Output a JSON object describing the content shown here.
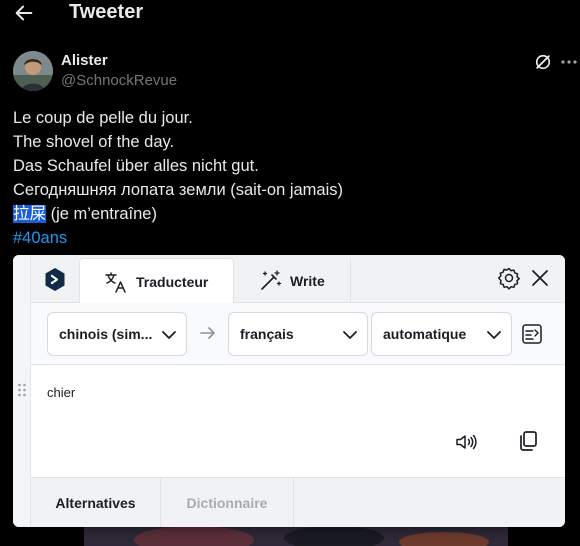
{
  "header": {
    "title": "Tweeter"
  },
  "tweet": {
    "author_name": "Alister",
    "author_handle": "@SchnockRevue",
    "lines": [
      "Le coup de pelle du jour.",
      "The shovel of the day.",
      "Das Schaufel über alles nicht gut.",
      "Сегодняшняя лопата земли (sait-on jamais)"
    ],
    "selected_text": "拉屎",
    "after_selection": " (je m’entraîne)",
    "hashtag": "#40ans"
  },
  "translator": {
    "tabs": {
      "translator": "Traducteur",
      "write": "Write"
    },
    "source_lang": "chinois (sim...",
    "target_lang": "français",
    "mode": "automatique",
    "result": "chier",
    "bottom_tabs": {
      "alternatives": "Alternatives",
      "dictionary": "Dictionnaire"
    },
    "colors": {
      "brand": "#0f2b46",
      "selection": "#1a5ed6",
      "hashtag": "#1d9bf0"
    }
  }
}
